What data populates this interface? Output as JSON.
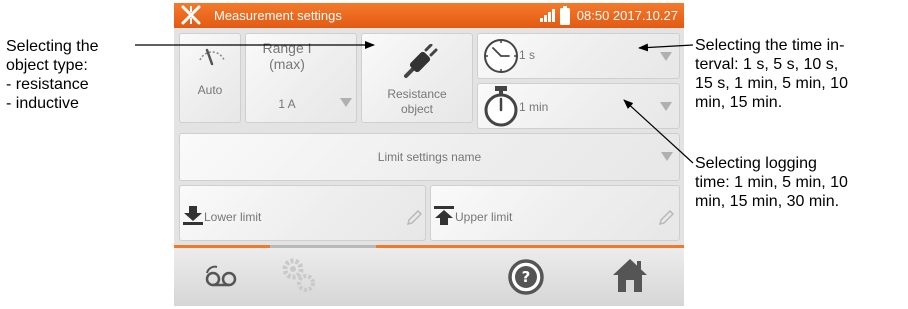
{
  "annotations": {
    "object_type": [
      "Selecting the",
      "object type:",
      "- resistance",
      "- inductive"
    ],
    "time_interval": [
      "Selecting the time in-",
      "terval: 1 s, 5 s, 10 s,",
      "15 s, 1 min, 5 min, 10",
      "min, 15 min."
    ],
    "logging_time": [
      "Selecting logging",
      "time: 1 min, 5 min, 10",
      "min, 15 min, 30 min."
    ]
  },
  "device": {
    "title": "Measurement settings",
    "clock": "08:50 2017.10.27",
    "tiles": {
      "auto_label": "Auto",
      "range_label": "Range I\n(max)",
      "range_value": "1 A",
      "object_label": "Resistance\nobject",
      "interval_value": "1 s",
      "logging_value": "1 min",
      "limit_name": "Limit settings name",
      "lower_limit": "Lower limit",
      "upper_limit": "Upper limit"
    }
  },
  "colors": {
    "topbar": "#e8631b",
    "accent_line": "#f07a2a",
    "icon_gray": "#666666",
    "home_icon": "#555555"
  },
  "icons": [
    "logo-icon",
    "signal-icon",
    "battery-icon",
    "gauge-icon",
    "cable-plug-icon",
    "clock-icon",
    "stopwatch-icon",
    "pencil-icon",
    "download-arrow-icon",
    "upload-arrow-icon",
    "recorder-icon",
    "gears-icon",
    "help-icon",
    "home-icon"
  ]
}
